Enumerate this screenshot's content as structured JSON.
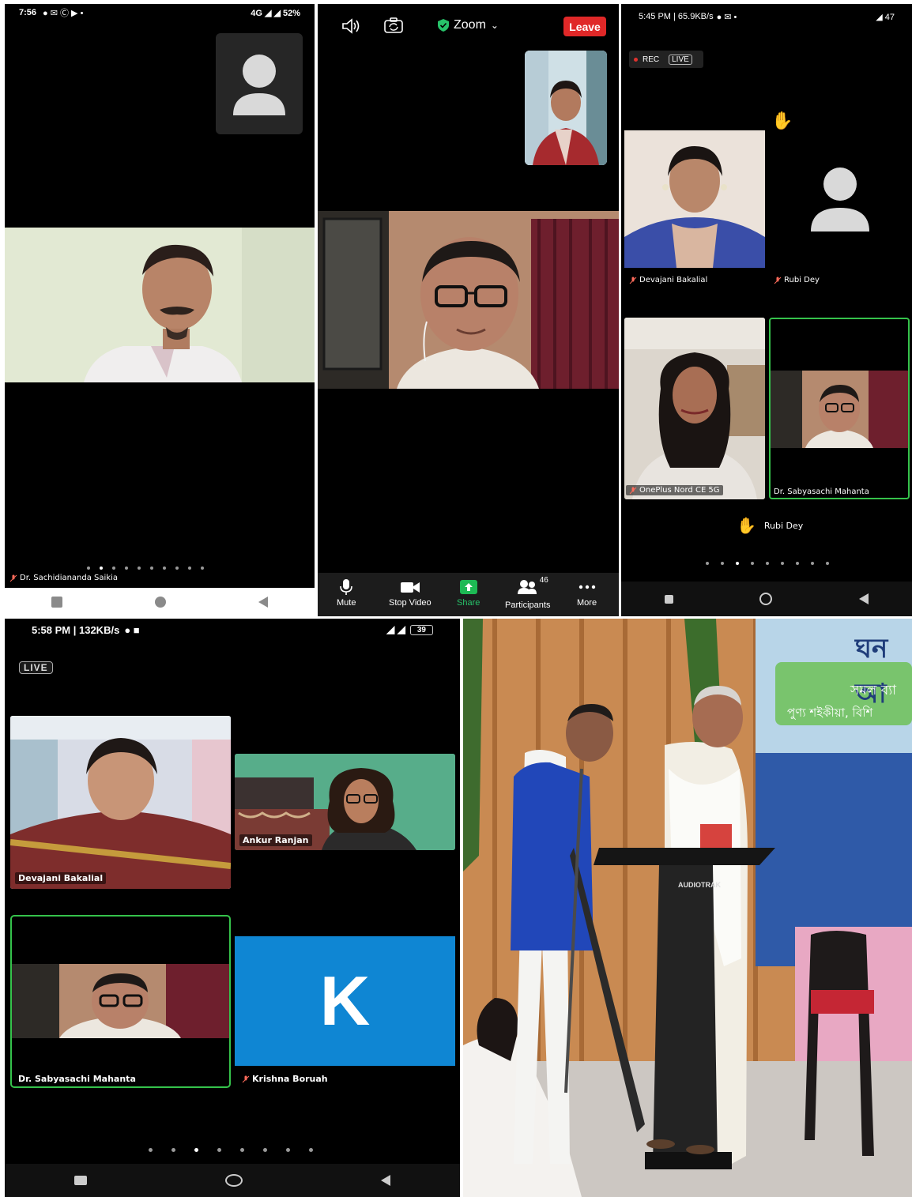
{
  "panel1": {
    "status": {
      "time": "7:56",
      "icons": "● ✉ Ⓒ ▶ •",
      "right": "4G ◢ ◢ 52%"
    },
    "participant_name": "Dr. Sachidiananda Saikia",
    "page_dots": 10,
    "page_active": 1
  },
  "panel2": {
    "header": {
      "app_title": "Zoom",
      "leave_label": "Leave"
    },
    "toolbar": [
      {
        "label": "Mute",
        "icon": "mic-icon"
      },
      {
        "label": "Stop Video",
        "icon": "video-icon"
      },
      {
        "label": "Share",
        "icon": "share-icon"
      },
      {
        "label": "Participants",
        "icon": "participants-icon",
        "badge": "46"
      },
      {
        "label": "More",
        "icon": "more-icon"
      }
    ],
    "colors": {
      "leave": "#e02828",
      "share": "#1db954",
      "verified": "#27c36a"
    }
  },
  "panel3": {
    "status": {
      "time": "5:45 PM | 65.9KB/s",
      "right": "◢ 47"
    },
    "rec_label": "REC",
    "live_label": "LIVE",
    "tiles": [
      {
        "name": "Devajani Bakalial"
      },
      {
        "name": "Rubi Dey"
      },
      {
        "name": "OnePlus Nord CE 5G"
      },
      {
        "name": "Dr. Sabyasachi Mahanta"
      }
    ],
    "raised_hand_name": "Rubi Dey",
    "page_dots": 9,
    "page_active": 2,
    "colors": {
      "active_speaker": "#35c24b",
      "rec_dot": "#e0322e"
    }
  },
  "panel4": {
    "status": {
      "time": "5:58 PM | 132KB/s",
      "battery": "39"
    },
    "live_label": "LIVE",
    "tiles": [
      {
        "name": "Devajani Bakalial"
      },
      {
        "name": "Ankur Ranjan"
      },
      {
        "name": "Dr. Sabyasachi Mahanta"
      },
      {
        "name": "Krishna Boruah",
        "initial": "K"
      }
    ],
    "page_dots": 8,
    "page_active": 2,
    "colors": {
      "avatar_tile": "#0f86d3",
      "active_speaker": "#35c24b"
    }
  },
  "panel5": {
    "banner_text_1": "ঘন আ",
    "banner_text_2": "সমল ব্যা",
    "banner_text_3": "পুণ্য শইকীয়া, বিশি",
    "podium_brand": "AUDIOTRAK"
  }
}
